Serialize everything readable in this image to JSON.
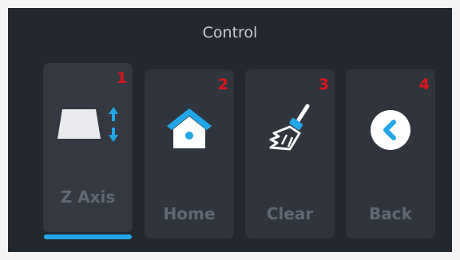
{
  "header": {
    "title": "Control"
  },
  "cards": [
    {
      "number": "1",
      "label": "Z Axis",
      "icon": "z-axis-icon"
    },
    {
      "number": "2",
      "label": "Home",
      "icon": "home-icon"
    },
    {
      "number": "3",
      "label": "Clear",
      "icon": "broom-icon"
    },
    {
      "number": "4",
      "label": "Back",
      "icon": "back-arrow-icon"
    }
  ],
  "colors": {
    "background": "#23272e",
    "card": "#30353d",
    "accent": "#22a6ea",
    "badge": "#e0141a",
    "label": "#616872"
  },
  "selected_card": "Z Axis"
}
